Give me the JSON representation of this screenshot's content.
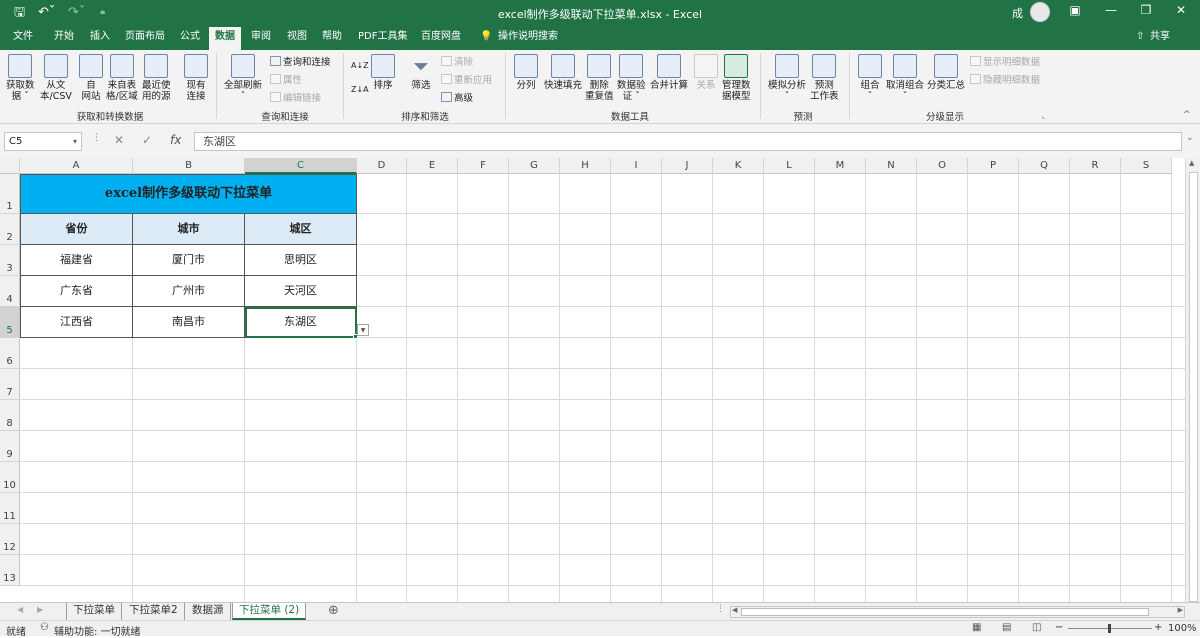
{
  "app": {
    "title": "excel制作多级联动下拉菜单.xlsx  -  Excel",
    "user": "成",
    "share": "共享",
    "search_hint": "操作说明搜索"
  },
  "quick_access": [
    "save-icon",
    "undo-icon",
    "redo-icon",
    "customize-icon"
  ],
  "tabs": [
    "文件",
    "开始",
    "插入",
    "页面布局",
    "公式",
    "数据",
    "审阅",
    "视图",
    "帮助",
    "PDF工具集",
    "百度网盘"
  ],
  "active_tab": "数据",
  "ribbon": {
    "groups": [
      "获取和转换数据",
      "查询和连接",
      "排序和筛选",
      "数据工具",
      "预测",
      "分级显示"
    ],
    "get_data": [
      "获取数\n据 ˇ",
      "从文\n本/CSV",
      "自\n网站",
      "来自表\n格/区域",
      "最近使\n用的源",
      "现有\n连接"
    ],
    "queries": {
      "refresh": "全部刷新\nˇ",
      "items": [
        "查询和连接",
        "属性",
        "编辑链接"
      ]
    },
    "sort": {
      "az": "A↓Z",
      "sort": "排序",
      "filter": "筛选",
      "clear": "清除",
      "reapply": "重新应用",
      "advanced": "高级"
    },
    "tools": [
      "分列",
      "快速填充",
      "删除\n重复值",
      "数据验\n证 ˇ",
      "合并计算",
      "关系",
      "管理数\n据模型"
    ],
    "forecast": [
      "模拟分析\nˇ",
      "预测\n工作表"
    ],
    "outline": {
      "group": "组合\nˇ",
      "ungroup": "取消组合\nˇ",
      "subtotal": "分类汇总",
      "show": "显示明细数据",
      "hide": "隐藏明细数据"
    }
  },
  "formula_bar": {
    "name_box": "C5",
    "formula": "东湖区"
  },
  "columns": [
    "A",
    "B",
    "C",
    "D",
    "E",
    "F",
    "G",
    "H",
    "I",
    "J",
    "K",
    "L",
    "M",
    "N",
    "O",
    "P",
    "Q",
    "R",
    "S"
  ],
  "rows": [
    "1",
    "2",
    "3",
    "4",
    "5",
    "6",
    "7",
    "8",
    "9",
    "10",
    "11",
    "12",
    "13"
  ],
  "selected_cell": "C5",
  "sheet": {
    "title": "excel制作多级联动下拉菜单",
    "headers": [
      "省份",
      "城市",
      "城区"
    ],
    "data": [
      [
        "福建省",
        "厦门市",
        "思明区"
      ],
      [
        "广东省",
        "广州市",
        "天河区"
      ],
      [
        "江西省",
        "南昌市",
        "东湖区"
      ]
    ]
  },
  "title_fill": "#00b0f0",
  "header_fill": "#ddebf7",
  "sheet_tabs": [
    "下拉菜单",
    "下拉菜单2",
    "数据源",
    "下拉菜单 (2)"
  ],
  "active_sheet": "下拉菜单 (2)",
  "status": {
    "ready": "就绪",
    "accessibility": "辅助功能: 一切就绪",
    "zoom": "100%"
  }
}
